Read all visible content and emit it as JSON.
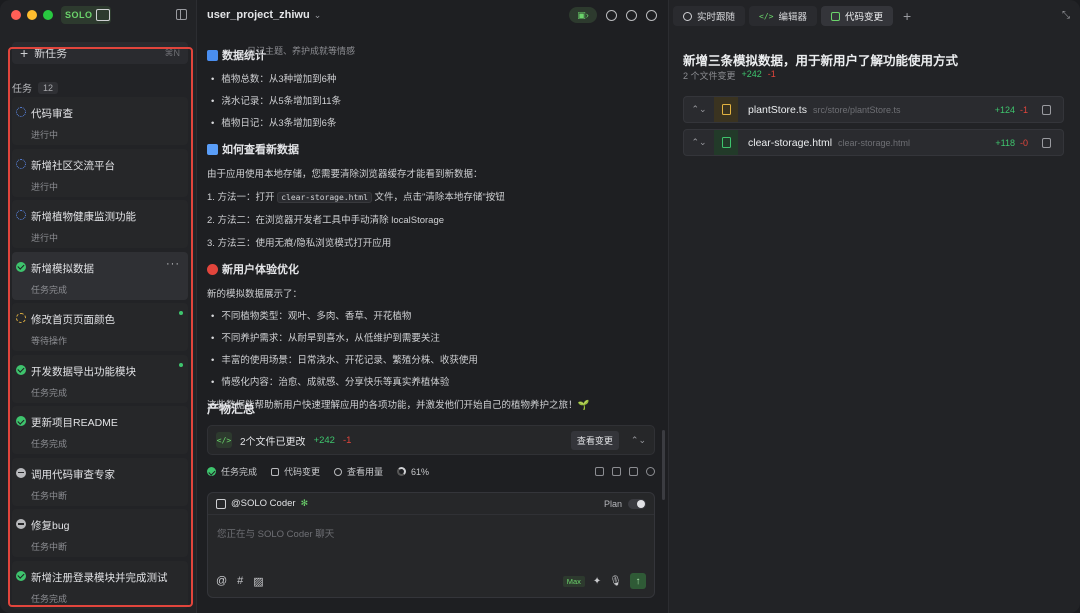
{
  "sidebar": {
    "logo_text": "SOLO",
    "new_task_label": "新任务",
    "new_task_shortcut": "⌘N",
    "tasks_label": "任务",
    "tasks_count": "12",
    "tasks": [
      {
        "title": "代码审查",
        "status": "进行中",
        "state": "progress"
      },
      {
        "title": "新增社区交流平台",
        "status": "进行中",
        "state": "progress"
      },
      {
        "title": "新增植物健康监测功能",
        "status": "进行中",
        "state": "progress"
      },
      {
        "title": "新增模拟数据",
        "status": "任务完成",
        "state": "done"
      },
      {
        "title": "修改首页页面颜色",
        "status": "等待操作",
        "state": "wait"
      },
      {
        "title": "开发数据导出功能模块",
        "status": "任务完成",
        "state": "done"
      },
      {
        "title": "更新项目README",
        "status": "任务完成",
        "state": "done"
      },
      {
        "title": "调用代码审查专家",
        "status": "任务中断",
        "state": "stop"
      },
      {
        "title": "修复bug",
        "status": "任务中断",
        "state": "stop"
      },
      {
        "title": "新增注册登录模块并完成测试",
        "status": "任务完成",
        "state": "done"
      }
    ]
  },
  "center": {
    "project_name": "user_project_zhiwu",
    "top_cut_text": "日记主题、养护成就等情感",
    "stats_heading": "数据统计",
    "stats": [
      "植物总数：从3种增加到6种",
      "浇水记录：从5条增加到11条",
      "植物日记：从3条增加到6条"
    ],
    "howto_heading": "如何查看新数据",
    "howto_para": "由于应用使用本地存储，您需要清除浏览器缓存才能看到新数据：",
    "method1_pre": "1. 方法一：打开 ",
    "method1_code": "clear-storage.html",
    "method1_post": " 文件，点击\"清除本地存储\"按钮",
    "method2": "2. 方法二：在浏览器开发者工具中手动清除 localStorage",
    "method3": "3. 方法三：使用无痕/隐私浏览模式打开应用",
    "ux_heading": "新用户体验优化",
    "ux_para": "新的模拟数据展示了：",
    "ux_items": [
      "不同植物类型：观叶、多肉、香草、开花植物",
      "不同养护需求：从耐旱到喜水，从低维护到需要关注",
      "丰富的使用场景：日常浇水、开花记录、繁殖分株、收获使用",
      "情感化内容：治愈、成就感、分享快乐等真实养植体验"
    ],
    "closing": "这些数据能帮助新用户快速理解应用的各项功能，并激发他们开始自己的植物养护之旅！🌱",
    "summary_heading": "产物汇总",
    "changes_label": "2个文件已更改",
    "changes_add": "+242",
    "changes_del": "-1",
    "view_changes": "查看变更",
    "footer_done": "任务完成",
    "footer_code": "代码变更",
    "footer_usage": "查看用量",
    "footer_pct": "61%",
    "agent_name": "@SOLO Coder",
    "plan_label": "Plan",
    "composer_placeholder": "您正在与 SOLO Coder 聊天",
    "max_label": "Max"
  },
  "right": {
    "tabs": [
      "实时跟随",
      "编辑器",
      "代码变更"
    ],
    "title": "新增三条模拟数据，用于新用户了解功能使用方式",
    "files_changed": "2 个文件变更",
    "total_add": "+242",
    "total_del": "-1",
    "files": [
      {
        "name": "plantStore.ts",
        "path": "src/store/plantStore.ts",
        "add": "+124",
        "del": "-1",
        "color": "#e3b341"
      },
      {
        "name": "clear-storage.html",
        "path": "clear-storage.html",
        "add": "+118",
        "del": "-0",
        "color": "#3ec46d"
      }
    ]
  }
}
